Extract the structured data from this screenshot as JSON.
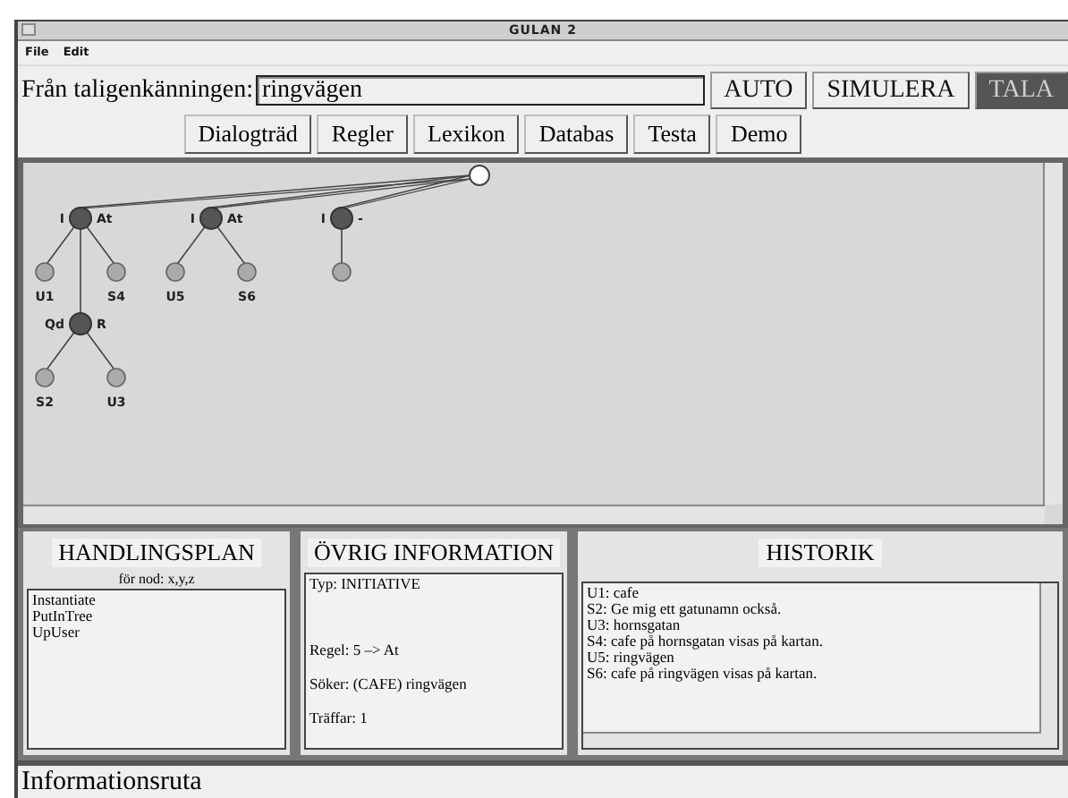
{
  "window": {
    "title": "GULAN 2"
  },
  "menu": [
    "File",
    "Edit"
  ],
  "input_row": {
    "label": "Från taligenkänningen:",
    "value": "ringvägen",
    "buttons": [
      {
        "label": "AUTO",
        "active": false
      },
      {
        "label": "SIMULERA",
        "active": false
      },
      {
        "label": "TALA",
        "active": true
      }
    ]
  },
  "tabs": [
    "Dialogträd",
    "Regler",
    "Lexikon",
    "Databas",
    "Testa",
    "Demo"
  ],
  "tree": {
    "root": {
      "children": [
        {
          "kind": "node",
          "left": "I",
          "right": "At",
          "children": [
            {
              "kind": "leaf",
              "label": "U1"
            },
            {
              "kind": "leaf",
              "label": "S4"
            },
            {
              "kind": "node",
              "left": "Qd",
              "right": "R",
              "children": [
                {
                  "kind": "leaf",
                  "label": "S2"
                },
                {
                  "kind": "leaf",
                  "label": "U3"
                }
              ]
            }
          ]
        },
        {
          "kind": "node",
          "left": "I",
          "right": "At",
          "children": [
            {
              "kind": "leaf",
              "label": "U5"
            },
            {
              "kind": "leaf",
              "label": "S6"
            }
          ]
        },
        {
          "kind": "node",
          "left": "I",
          "right": "-",
          "children": [
            {
              "kind": "leaf"
            }
          ]
        }
      ]
    }
  },
  "handlingsplan": {
    "title": "HANDLINGSPLAN",
    "subtitle": "för nod: x,y,z",
    "items": [
      "Instantiate",
      "PutInTree",
      "UpUser"
    ]
  },
  "ovrig_information": {
    "title": "ÖVRIG INFORMATION",
    "lines": [
      "Typ: INITIATIVE",
      "Regel: 5 –> At",
      "Söker: (CAFE) ringvägen",
      "Träffar: 1"
    ]
  },
  "historik": {
    "title": "HISTORIK",
    "lines": [
      "U1: cafe",
      "S2: Ge mig ett gatunamn också.",
      "U3: hornsgatan",
      "S4: cafe på hornsgatan visas på kartan.",
      "U5: ringvägen",
      "S6: cafe på ringvägen visas på kartan."
    ]
  },
  "status_bar": "Informationsruta"
}
